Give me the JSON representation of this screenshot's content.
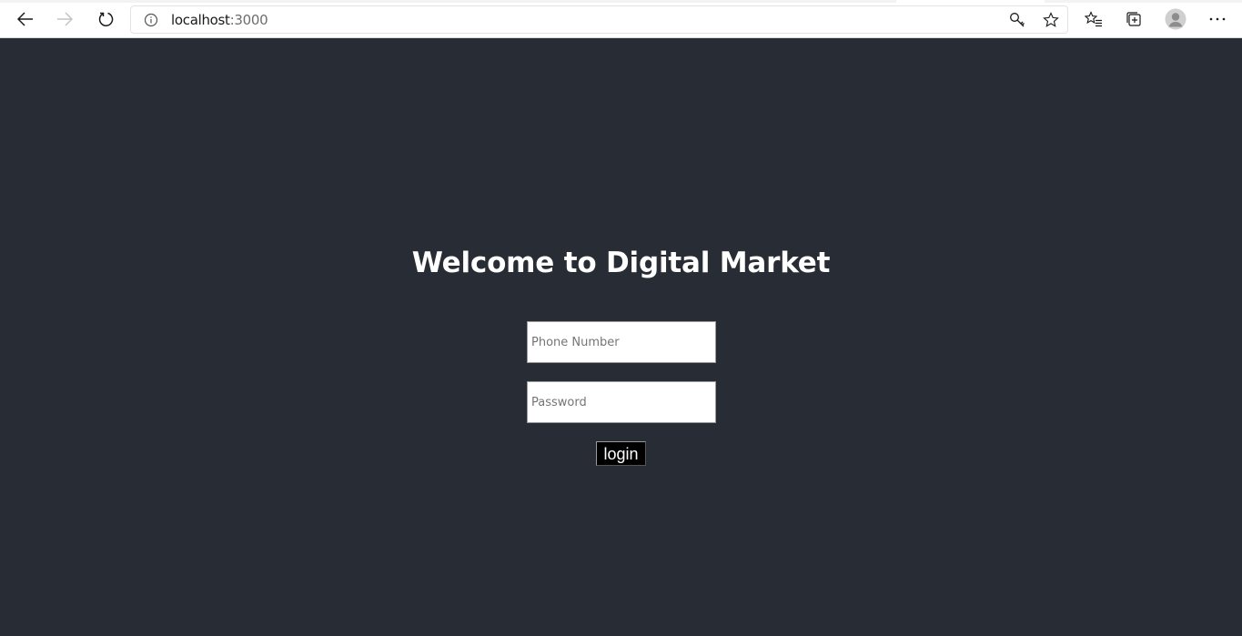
{
  "browser": {
    "address": {
      "host": "localhost",
      "port": ":3000"
    },
    "icons": {
      "back": "back-arrow-icon",
      "forward": "forward-arrow-icon",
      "refresh": "refresh-icon",
      "site_info": "info-icon",
      "key": "key-icon",
      "favorite": "star-icon",
      "favorites_list": "favorites-icon",
      "collections": "collections-icon",
      "profile": "profile-avatar-icon",
      "more": "more-dots-icon"
    }
  },
  "page": {
    "background": "#282c34",
    "title": "Welcome to Digital Market",
    "form": {
      "phone_placeholder": "Phone Number",
      "password_placeholder": "Password",
      "login_label": "login"
    }
  }
}
